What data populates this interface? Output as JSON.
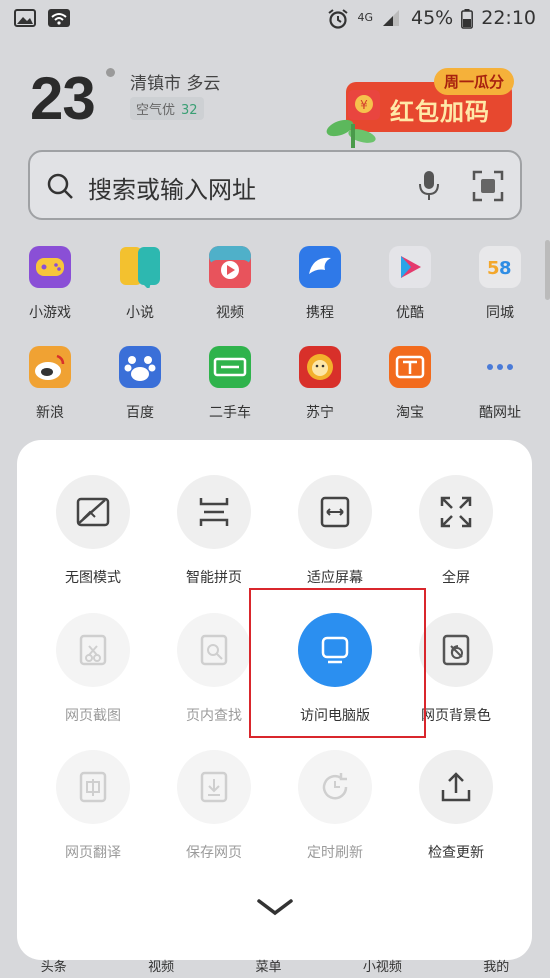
{
  "status_bar": {
    "network": "4G",
    "battery": "45%",
    "time": "22:10"
  },
  "weather": {
    "temperature": "23",
    "city_weather": "清镇市  多云",
    "air_quality_label": "空气优",
    "air_quality_value": "32"
  },
  "promo": {
    "tag": "周一瓜分",
    "title": "红包加码"
  },
  "search": {
    "placeholder": "搜索或输入网址"
  },
  "apps_row1": [
    {
      "label": "小游戏",
      "color": "#8a4fd6"
    },
    {
      "label": "小说",
      "color": "#f3c12f"
    },
    {
      "label": "视频",
      "color": "#e8535c"
    },
    {
      "label": "携程",
      "color": "#2f79e8"
    },
    {
      "label": "优酷",
      "color": "#e53a6d"
    },
    {
      "label": "同城",
      "color": "#f0f0f0"
    }
  ],
  "apps_row2": [
    {
      "label": "新浪",
      "color": "#f0a233"
    },
    {
      "label": "百度",
      "color": "#3a6fd8"
    },
    {
      "label": "二手车",
      "color": "#2fb34c"
    },
    {
      "label": "苏宁",
      "color": "#d8302a"
    },
    {
      "label": "淘宝",
      "color": "#f26b1d"
    },
    {
      "label": "酷网址",
      "color": "#e6e6e6"
    }
  ],
  "tools": {
    "no_image": "无图模式",
    "smart_page": "智能拼页",
    "fit_screen": "适应屏幕",
    "fullscreen": "全屏",
    "screenshot": "网页截图",
    "find_in_page": "页内查找",
    "desktop_version": "访问电脑版",
    "page_background": "网页背景色",
    "translate": "网页翻译",
    "save_page": "保存网页",
    "auto_refresh": "定时刷新",
    "check_update": "检查更新"
  },
  "bottom_nav": [
    "头条",
    "视频",
    "菜单",
    "小视频",
    "我的"
  ],
  "accent_color": "#2b8ff0",
  "highlight_color": "#d9262c"
}
